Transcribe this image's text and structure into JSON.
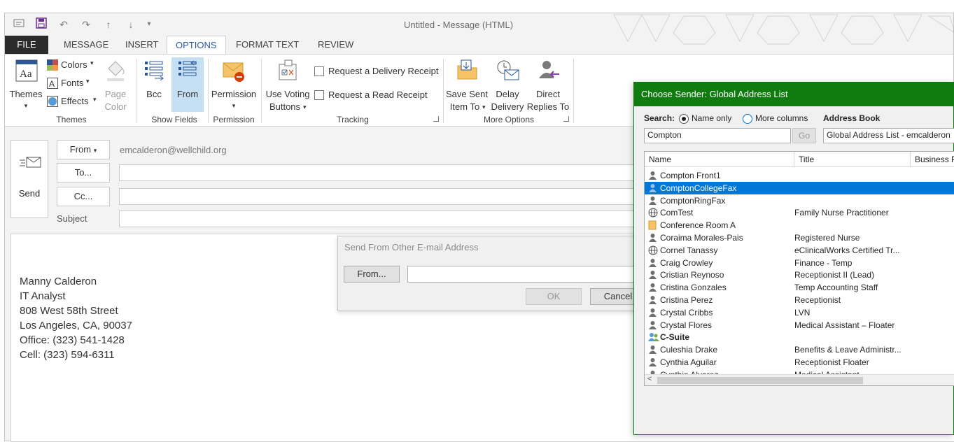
{
  "window": {
    "title": "Untitled - Message (HTML)"
  },
  "tabs": [
    "FILE",
    "MESSAGE",
    "INSERT",
    "OPTIONS",
    "FORMAT TEXT",
    "REVIEW"
  ],
  "ribbon": {
    "themes": {
      "themes_label": "Themes",
      "colors": "Colors",
      "fonts": "Fonts",
      "effects": "Effects",
      "page_color_1": "Page",
      "page_color_2": "Color",
      "group": "Themes"
    },
    "show_fields": {
      "bcc": "Bcc",
      "from": "From",
      "group": "Show Fields"
    },
    "permission": {
      "label": "Permission",
      "group": "Permission"
    },
    "tracking": {
      "voting_1": "Use Voting",
      "voting_2": "Buttons",
      "delivery_receipt": "Request a Delivery Receipt",
      "read_receipt": "Request a Read Receipt",
      "group": "Tracking"
    },
    "more_options": {
      "save_1": "Save Sent",
      "save_2": "Item To",
      "delay_1": "Delay",
      "delay_2": "Delivery",
      "direct_1": "Direct",
      "direct_2": "Replies To",
      "group": "More Options"
    }
  },
  "message": {
    "send": "Send",
    "from_btn": "From",
    "from_address": "emcalderon@wellchild.org",
    "to_btn": "To...",
    "cc_btn": "Cc...",
    "subject_label": "Subject"
  },
  "signature": [
    "Manny Calderon",
    "IT Analyst",
    "808 West 58th Street",
    "Los Angeles, CA, 90037",
    "Office: (323) 541-1428",
    "Cell: (323) 594-6311"
  ],
  "send_from_dialog": {
    "title": "Send From Other E-mail Address",
    "from_btn": "From...",
    "ok": "OK",
    "cancel": "Cancel"
  },
  "chooser": {
    "title": "Choose Sender: Global Address List",
    "search_label": "Search:",
    "name_only": "Name only",
    "more_columns": "More columns",
    "address_book_label": "Address Book",
    "search_value": "Compton",
    "go": "Go",
    "address_book_value": "Global Address List - emcalderon",
    "columns": [
      "Name",
      "Title",
      "Business P"
    ],
    "rows": [
      {
        "name": "Compton Front1",
        "title": "",
        "icon": "person"
      },
      {
        "name": "ComptonCollegeFax",
        "title": "",
        "icon": "person",
        "selected": true
      },
      {
        "name": "ComptonRingFax",
        "title": "",
        "icon": "person"
      },
      {
        "name": "ComTest",
        "title": "Family Nurse Practitioner",
        "icon": "globe"
      },
      {
        "name": "Conference Room A",
        "title": "",
        "icon": "room"
      },
      {
        "name": "Coraima Morales-Pais",
        "title": "Registered Nurse",
        "icon": "person"
      },
      {
        "name": "Cornel Tanassy",
        "title": "eClinicalWorks Certified Tr...",
        "icon": "globe"
      },
      {
        "name": "Craig Crowley",
        "title": "Finance - Temp",
        "icon": "person"
      },
      {
        "name": "Cristian Reynoso",
        "title": "Receptionist II (Lead)",
        "icon": "person"
      },
      {
        "name": "Cristina Gonzales",
        "title": "Temp Accounting Staff",
        "icon": "person"
      },
      {
        "name": "Cristina Perez",
        "title": "Receptionist",
        "icon": "person"
      },
      {
        "name": "Crystal Cribbs",
        "title": "LVN",
        "icon": "person"
      },
      {
        "name": "Crystal Flores",
        "title": "Medical Assistant – Floater",
        "icon": "person"
      },
      {
        "name": "C-Suite",
        "title": "",
        "icon": "group",
        "bold": true
      },
      {
        "name": "Culeshia Drake",
        "title": "Benefits & Leave Administr...",
        "icon": "person"
      },
      {
        "name": "Cynthia Aguilar",
        "title": "Receptionist Floater",
        "icon": "person"
      },
      {
        "name": "Cynthia Alvarez",
        "title": "Medical Assistant",
        "icon": "person"
      }
    ]
  }
}
